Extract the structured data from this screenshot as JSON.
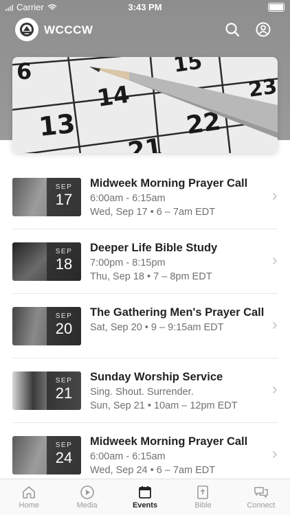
{
  "status_bar": {
    "carrier": "Carrier",
    "time": "3:43 PM"
  },
  "app": {
    "name": "WCCCW"
  },
  "hero": {
    "numbers": [
      "6",
      "14",
      "15",
      "13",
      "22",
      "23",
      "21"
    ]
  },
  "events": [
    {
      "month": "SEP",
      "day": "17",
      "title": "Midweek Morning Prayer Call",
      "line1": "6:00am - 6:15am",
      "line2": "Wed, Sep 17 • 6 – 7am EDT"
    },
    {
      "month": "SEP",
      "day": "18",
      "title": "Deeper Life Bible Study",
      "line1": "7:00pm - 8:15pm",
      "line2": "Thu, Sep 18 • 7 – 8pm EDT"
    },
    {
      "month": "SEP",
      "day": "20",
      "title": "The Gathering Men's Prayer Call",
      "line1": "Sat, Sep 20 • 9 – 9:15am EDT",
      "line2": ""
    },
    {
      "month": "SEP",
      "day": "21",
      "title": "Sunday Worship Service",
      "line1": "Sing. Shout. Surrender.",
      "line2": "Sun, Sep 21 • 10am – 12pm EDT"
    },
    {
      "month": "SEP",
      "day": "24",
      "title": "Midweek Morning Prayer Call",
      "line1": "6:00am - 6:15am",
      "line2": "Wed, Sep 24 • 6 – 7am EDT"
    }
  ],
  "tabs": [
    {
      "label": "Home",
      "icon": "home-icon",
      "active": false
    },
    {
      "label": "Media",
      "icon": "play-icon",
      "active": false
    },
    {
      "label": "Events",
      "icon": "calendar-icon",
      "active": true
    },
    {
      "label": "Bible",
      "icon": "bible-icon",
      "active": false
    },
    {
      "label": "Connect",
      "icon": "chat-icon",
      "active": false
    }
  ],
  "colors": {
    "header": "#8e8e8e",
    "active_tab": "#222222",
    "inactive_tab": "#9a9a9a"
  }
}
